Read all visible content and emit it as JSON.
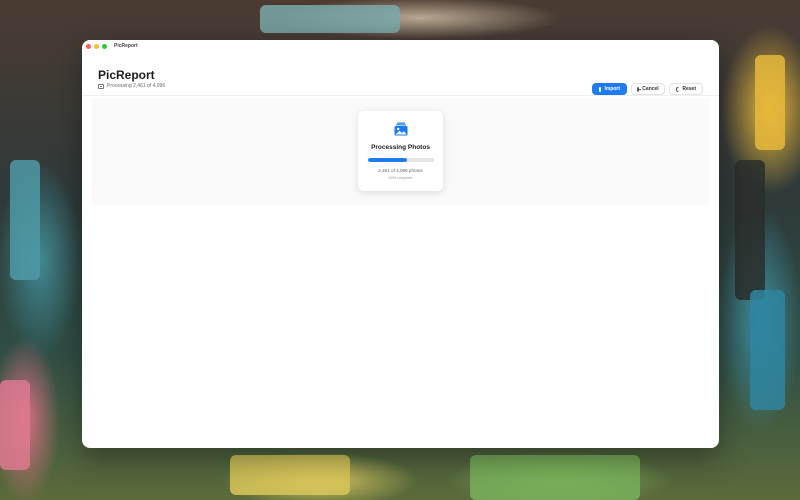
{
  "window": {
    "title": "PicReport"
  },
  "header": {
    "app_title": "PicReport",
    "status_text": "Processing 2,461 of 4,096",
    "status_icon": "photos-icon"
  },
  "toolbar": {
    "import_label": "Import",
    "cancel_label": "Cancel",
    "reset_label": "Reset",
    "import_icon": "import-icon",
    "cancel_icon": "cancel-circle-icon",
    "reset_icon": "reset-icon"
  },
  "progress_card": {
    "icon": "photo-stack-icon",
    "title": "Processing Photos",
    "count_text": "2,461 of 4,096 photos",
    "percent_text": "60% complete",
    "progress": 0.6
  },
  "colors": {
    "accent": "#1e7cf2",
    "traffic_red": "#ff5f57",
    "traffic_yellow": "#febc2e",
    "traffic_green": "#28c840"
  }
}
